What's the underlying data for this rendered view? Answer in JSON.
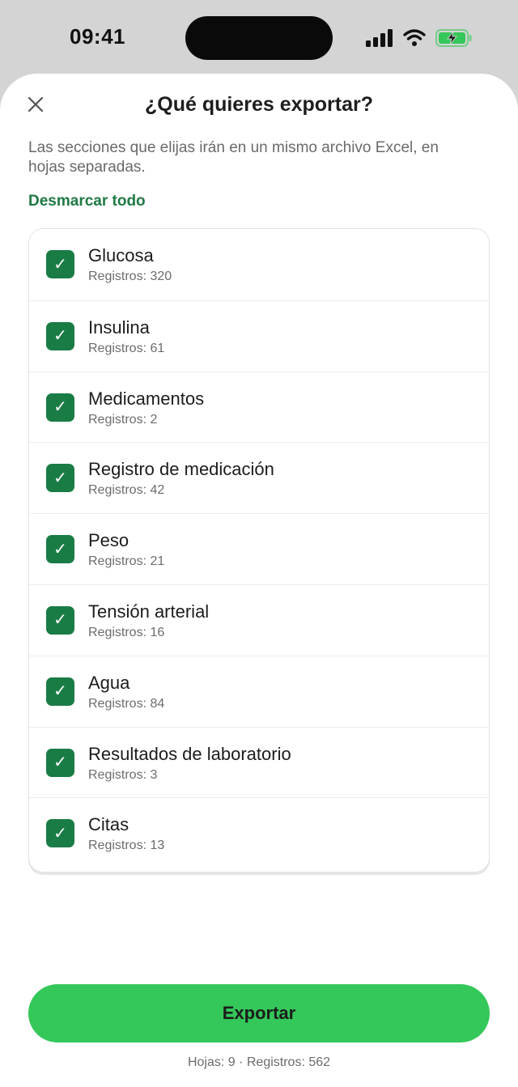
{
  "status_bar": {
    "time": "09:41",
    "icons": [
      "signal-icon",
      "wifi-icon",
      "battery-charging-icon"
    ]
  },
  "sheet": {
    "title": "¿Qué quieres exportar?",
    "close_icon": "close-icon",
    "subtitle": "Las secciones que elijas irán en un mismo archivo Excel, en hojas separadas.",
    "deselect_all_label": "Desmarcar todo"
  },
  "sections": [
    {
      "name": "Glucosa",
      "records": "Registros: 320",
      "checked": true
    },
    {
      "name": "Insulina",
      "records": "Registros: 61",
      "checked": true
    },
    {
      "name": "Medicamentos",
      "records": "Registros: 2",
      "checked": true
    },
    {
      "name": "Registro de medicación",
      "records": "Registros: 42",
      "checked": true
    },
    {
      "name": "Peso",
      "records": "Registros: 21",
      "checked": true
    },
    {
      "name": "Tensión arterial",
      "records": "Registros: 16",
      "checked": true
    },
    {
      "name": "Agua",
      "records": "Registros: 84",
      "checked": true
    },
    {
      "name": "Resultados de laboratorio",
      "records": "Registros: 3",
      "checked": true
    },
    {
      "name": "Citas",
      "records": "Registros: 13",
      "checked": true
    }
  ],
  "footer": {
    "export_label": "Exportar",
    "summary": "Hojas: 9 · Registros: 562"
  },
  "colors": {
    "accent_green": "#1a7c45",
    "button_green": "#34c759",
    "battery_green": "#34c759"
  }
}
